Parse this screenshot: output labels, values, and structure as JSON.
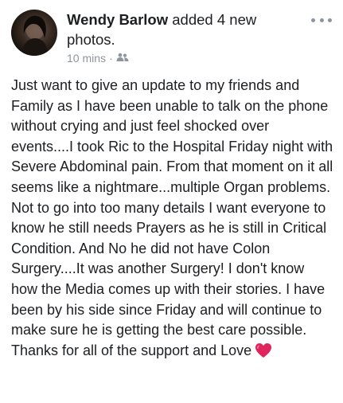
{
  "post": {
    "author": "Wendy Barlow",
    "action_text": " added 4 new photos.",
    "timestamp": "10 mins",
    "separator": "·",
    "privacy_icon": "friends-icon",
    "menu_icon": "more-options-icon",
    "body": "Just want to give an update to my friends and Family as I have been unable to talk on the phone without crying and just feel shocked over events....I took Ric to the Hospital Friday night with Severe Abdominal pain. From that moment on it all seems like a nightmare...multiple Organ  problems. Not to go into too many details I want everyone to know he still needs Prayers as he is still in Critical Condition.  And No he did not have Colon Surgery....It was another Surgery!  I don't know how the Media comes up with their stories. I have been by his side since Friday and will continue to make sure he is getting the best care possible.  Thanks for all of the support and Love",
    "emoji_icon": "red-heart-icon"
  },
  "colors": {
    "text": "#1c1e21",
    "meta": "#90949c",
    "heart": "#e0245e"
  }
}
